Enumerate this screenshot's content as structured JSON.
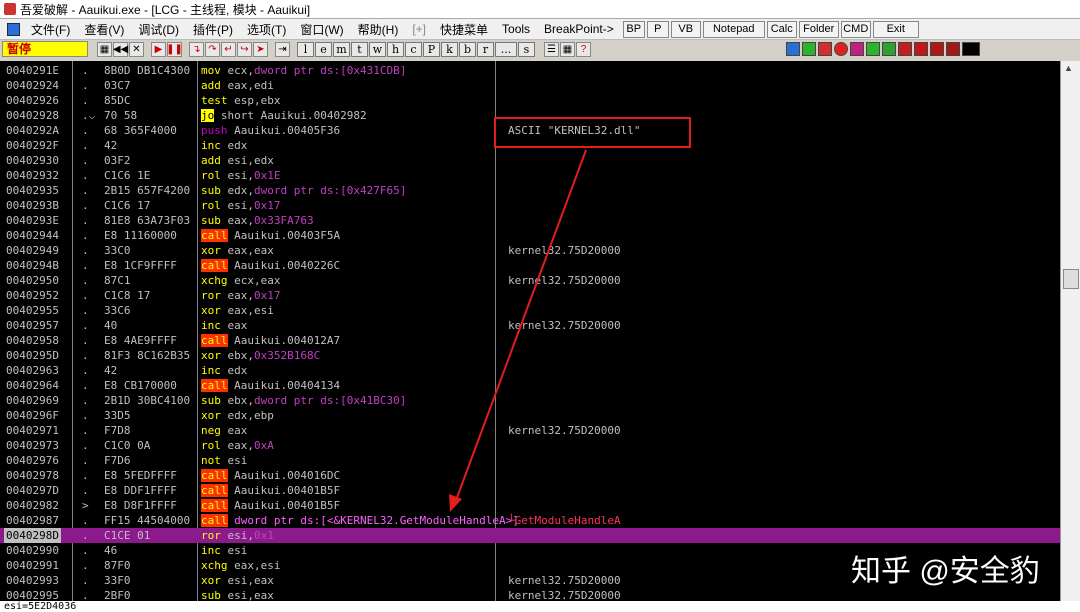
{
  "window": {
    "title": "吾爱破解 - Aauikui.exe - [LCG - 主线程, 模块 - Aauikui]"
  },
  "menu": {
    "items": [
      "文件(F)",
      "查看(V)",
      "调试(D)",
      "插件(P)",
      "选项(T)",
      "窗口(W)",
      "帮助(H)",
      "[+]",
      "快捷菜单",
      "Tools",
      "BreakPoint->"
    ],
    "quick": [
      "BP",
      "P",
      "VB",
      "Notepad",
      "Calc",
      "Folder",
      "CMD",
      "Exit"
    ]
  },
  "toolbar": {
    "status": "暂停",
    "letters": [
      "l",
      "e",
      "m",
      "t",
      "w",
      "h",
      "c",
      "P",
      "k",
      "b",
      "r",
      "...",
      "s"
    ]
  },
  "annotation": {
    "color": "#e21e1e"
  },
  "rows": [
    {
      "addr": "0040291E",
      "mark": ".",
      "hex": "8B0D DB1C4300",
      "m": "mov",
      "ops": [
        [
          "ecx,",
          "op"
        ],
        [
          "dword ptr ds:[0x431CDB]",
          "opm"
        ]
      ],
      "comment": ""
    },
    {
      "addr": "00402924",
      "mark": ".",
      "hex": "03C7",
      "m": "add",
      "ops": [
        [
          "eax,edi",
          "op"
        ]
      ],
      "comment": ""
    },
    {
      "addr": "00402926",
      "mark": ".",
      "hex": "85DC",
      "m": "test",
      "ops": [
        [
          "esp,ebx",
          "op"
        ]
      ],
      "comment": ""
    },
    {
      "addr": "00402928",
      "mark": ".⌵",
      "hex": "70 58",
      "m": "jo",
      "ops": [
        [
          "short Aauikui.00402982",
          "op"
        ]
      ],
      "comment": ""
    },
    {
      "addr": "0040292A",
      "mark": ".",
      "hex": "68 365F4000",
      "m": "push",
      "ops": [
        [
          "Aauikui.00405F36",
          "op"
        ]
      ],
      "comment": "ASCII \"KERNEL32.dll\""
    },
    {
      "addr": "0040292F",
      "mark": ".",
      "hex": "42",
      "m": "inc",
      "ops": [
        [
          "edx",
          "op"
        ]
      ],
      "comment": ""
    },
    {
      "addr": "00402930",
      "mark": ".",
      "hex": "03F2",
      "m": "add",
      "ops": [
        [
          "esi,edx",
          "op"
        ]
      ],
      "comment": ""
    },
    {
      "addr": "00402932",
      "mark": ".",
      "hex": "C1C6 1E",
      "m": "rol",
      "ops": [
        [
          "esi,",
          "op"
        ],
        [
          "0x1E",
          "opm"
        ]
      ],
      "comment": ""
    },
    {
      "addr": "00402935",
      "mark": ".",
      "hex": "2B15 657F4200",
      "m": "sub",
      "ops": [
        [
          "edx,",
          "op"
        ],
        [
          "dword ptr ds:[0x427F65]",
          "opm"
        ]
      ],
      "comment": ""
    },
    {
      "addr": "0040293B",
      "mark": ".",
      "hex": "C1C6 17",
      "m": "rol",
      "ops": [
        [
          "esi,",
          "op"
        ],
        [
          "0x17",
          "opm"
        ]
      ],
      "comment": ""
    },
    {
      "addr": "0040293E",
      "mark": ".",
      "hex": "81E8 63A73F03",
      "m": "sub",
      "ops": [
        [
          "eax,",
          "op"
        ],
        [
          "0x33FA763",
          "opm"
        ]
      ],
      "comment": ""
    },
    {
      "addr": "00402944",
      "mark": ".",
      "hex": "E8 11160000",
      "m": "call",
      "ops": [
        [
          "Aauikui.00403F5A",
          "op"
        ]
      ],
      "comment": ""
    },
    {
      "addr": "00402949",
      "mark": ".",
      "hex": "33C0",
      "m": "xor",
      "ops": [
        [
          "eax,eax",
          "op"
        ]
      ],
      "comment": "kernel32.75D20000"
    },
    {
      "addr": "0040294B",
      "mark": ".",
      "hex": "E8 1CF9FFFF",
      "m": "call",
      "ops": [
        [
          "Aauikui.0040226C",
          "op"
        ]
      ],
      "comment": ""
    },
    {
      "addr": "00402950",
      "mark": ".",
      "hex": "87C1",
      "m": "xchg",
      "ops": [
        [
          "ecx,eax",
          "op"
        ]
      ],
      "comment": "kernel32.75D20000"
    },
    {
      "addr": "00402952",
      "mark": ".",
      "hex": "C1C8 17",
      "m": "ror",
      "ops": [
        [
          "eax,",
          "op"
        ],
        [
          "0x17",
          "opm"
        ]
      ],
      "comment": ""
    },
    {
      "addr": "00402955",
      "mark": ".",
      "hex": "33C6",
      "m": "xor",
      "ops": [
        [
          "eax,esi",
          "op"
        ]
      ],
      "comment": ""
    },
    {
      "addr": "00402957",
      "mark": ".",
      "hex": "40",
      "m": "inc",
      "ops": [
        [
          "eax",
          "op"
        ]
      ],
      "comment": "kernel32.75D20000"
    },
    {
      "addr": "00402958",
      "mark": ".",
      "hex": "E8 4AE9FFFF",
      "m": "call",
      "ops": [
        [
          "Aauikui.004012A7",
          "op"
        ]
      ],
      "comment": ""
    },
    {
      "addr": "0040295D",
      "mark": ".",
      "hex": "81F3 8C162B35",
      "m": "xor",
      "ops": [
        [
          "ebx,",
          "op"
        ],
        [
          "0x352B168C",
          "opm"
        ]
      ],
      "comment": ""
    },
    {
      "addr": "00402963",
      "mark": ".",
      "hex": "42",
      "m": "inc",
      "ops": [
        [
          "edx",
          "op"
        ]
      ],
      "comment": ""
    },
    {
      "addr": "00402964",
      "mark": ".",
      "hex": "E8 CB170000",
      "m": "call",
      "ops": [
        [
          "Aauikui.00404134",
          "op"
        ]
      ],
      "comment": ""
    },
    {
      "addr": "00402969",
      "mark": ".",
      "hex": "2B1D 30BC4100",
      "m": "sub",
      "ops": [
        [
          "ebx,",
          "op"
        ],
        [
          "dword ptr ds:[0x41BC30]",
          "opm"
        ]
      ],
      "comment": ""
    },
    {
      "addr": "0040296F",
      "mark": ".",
      "hex": "33D5",
      "m": "xor",
      "ops": [
        [
          "edx,ebp",
          "op"
        ]
      ],
      "comment": ""
    },
    {
      "addr": "00402971",
      "mark": ".",
      "hex": "F7D8",
      "m": "neg",
      "ops": [
        [
          "eax",
          "op"
        ]
      ],
      "comment": "kernel32.75D20000"
    },
    {
      "addr": "00402973",
      "mark": ".",
      "hex": "C1C0 0A",
      "m": "rol",
      "ops": [
        [
          "eax,",
          "op"
        ],
        [
          "0xA",
          "opm"
        ]
      ],
      "comment": ""
    },
    {
      "addr": "00402976",
      "mark": ".",
      "hex": "F7D6",
      "m": "not",
      "ops": [
        [
          "esi",
          "op"
        ]
      ],
      "comment": ""
    },
    {
      "addr": "00402978",
      "mark": ".",
      "hex": "E8 5FEDFFFF",
      "m": "call",
      "ops": [
        [
          "Aauikui.004016DC",
          "op"
        ]
      ],
      "comment": ""
    },
    {
      "addr": "0040297D",
      "mark": ".",
      "hex": "E8 DDF1FFFF",
      "m": "call",
      "ops": [
        [
          "Aauikui.00401B5F",
          "op"
        ]
      ],
      "comment": ""
    },
    {
      "addr": "00402982",
      "mark": ">",
      "hex": "E8 D8F1FFFF",
      "m": "call",
      "ops": [
        [
          "Aauikui.00401B5F",
          "op"
        ]
      ],
      "comment": ""
    },
    {
      "addr": "00402987",
      "mark": ".",
      "hex": "FF15 44504000",
      "m": "call",
      "ops": [
        [
          "dword ptr ds:[<&KERNEL32.GetModuleHandleA>]",
          "opm"
        ]
      ],
      "comment": "└GetModuleHandleA"
    },
    {
      "addr": "0040298D",
      "mark": ".",
      "hex": "C1CE 01",
      "m": "ror",
      "ops": [
        [
          "esi,",
          "op"
        ],
        [
          "0x1",
          "opm"
        ]
      ],
      "comment": "",
      "sel": true
    },
    {
      "addr": "00402990",
      "mark": ".",
      "hex": "46",
      "m": "inc",
      "ops": [
        [
          "esi",
          "op"
        ]
      ],
      "comment": ""
    },
    {
      "addr": "00402991",
      "mark": ".",
      "hex": "87F0",
      "m": "xchg",
      "ops": [
        [
          "eax,esi",
          "op"
        ]
      ],
      "comment": ""
    },
    {
      "addr": "00402993",
      "mark": ".",
      "hex": "33F0",
      "m": "xor",
      "ops": [
        [
          "esi,eax",
          "op"
        ]
      ],
      "comment": "kernel32.75D20000"
    },
    {
      "addr": "00402995",
      "mark": ".",
      "hex": "2BF0",
      "m": "sub",
      "ops": [
        [
          "esi,eax",
          "op"
        ]
      ],
      "comment": "kernel32.75D20000"
    }
  ],
  "status_bar": {
    "text": "esi=5E2D4036"
  },
  "watermark": {
    "text": "知乎 @安全豹"
  }
}
